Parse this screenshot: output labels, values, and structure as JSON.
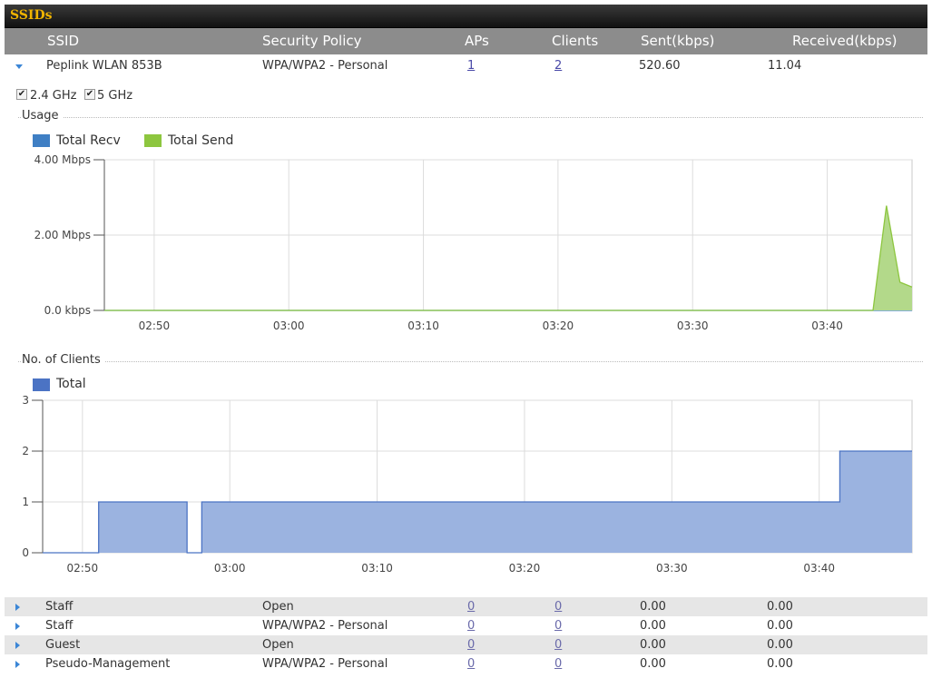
{
  "panel": {
    "title": "SSIDs"
  },
  "columns": {
    "ssid": "SSID",
    "security": "Security Policy",
    "aps": "APs",
    "clients": "Clients",
    "sent": "Sent(kbps)",
    "received": "Received(kbps)"
  },
  "expanded_row": {
    "ssid": "Peplink WLAN 853B",
    "security": "WPA/WPA2 - Personal",
    "aps": "1",
    "clients": "2",
    "sent": "520.60",
    "received": "11.04",
    "band_24": "2.4 GHz",
    "band_5": "5 GHz"
  },
  "rows": [
    {
      "ssid": "Staff",
      "security": "Open",
      "aps": "0",
      "clients": "0",
      "sent": "0.00",
      "received": "0.00"
    },
    {
      "ssid": "Staff",
      "security": "WPA/WPA2 - Personal",
      "aps": "0",
      "clients": "0",
      "sent": "0.00",
      "received": "0.00"
    },
    {
      "ssid": "Guest",
      "security": "Open",
      "aps": "0",
      "clients": "0",
      "sent": "0.00",
      "received": "0.00"
    },
    {
      "ssid": "Pseudo-Management",
      "security": "WPA/WPA2 - Personal",
      "aps": "0",
      "clients": "0",
      "sent": "0.00",
      "received": "0.00"
    }
  ],
  "usage": {
    "section_label": "Usage",
    "legend_recv": "Total Recv",
    "legend_send": "Total Send"
  },
  "clients_chart": {
    "section_label": "No. of Clients",
    "legend_total": "Total"
  },
  "colors": {
    "recv": "#3f7fc4",
    "send": "#8dc63f",
    "send_fill": "#b3d98a",
    "total": "#4b73c4",
    "total_fill": "#9bb3e0"
  },
  "chart_data": [
    {
      "type": "area",
      "ytick_labels": [
        "0.0 kbps",
        "2.00 Mbps",
        "4.00 Mbps"
      ],
      "ytick_values": [
        0,
        2,
        4
      ],
      "xtick_labels": [
        "02:50",
        "03:00",
        "03:10",
        "03:20",
        "03:30",
        "03:40"
      ],
      "x_minutes_tick": [
        50,
        60,
        70,
        80,
        90,
        100
      ],
      "xlim": [
        46.3,
        106.3
      ],
      "ylim": [
        0,
        4
      ],
      "series": [
        {
          "name": "Total Recv",
          "x": [
            46.3,
            106.3
          ],
          "y": [
            0,
            0
          ]
        },
        {
          "name": "Total Send",
          "x": [
            46.3,
            102.4,
            103.4,
            104.4,
            105.4,
            106.3
          ],
          "y": [
            0,
            0,
            0,
            2.78,
            0.75,
            0.62
          ]
        }
      ],
      "legend": "top-left",
      "grid": true
    },
    {
      "type": "area",
      "ytick_labels": [
        "0",
        "1",
        "2",
        "3"
      ],
      "ytick_values": [
        0,
        1,
        2,
        3
      ],
      "xtick_labels": [
        "02:50",
        "03:00",
        "03:10",
        "03:20",
        "03:30",
        "03:40"
      ],
      "x_minutes_tick": [
        50,
        60,
        70,
        80,
        90,
        100
      ],
      "xlim": [
        47.3,
        106.3
      ],
      "ylim": [
        0,
        3
      ],
      "series": [
        {
          "name": "Total",
          "x": [
            47.3,
            51.1,
            51.1,
            57.1,
            57.1,
            58.1,
            58.1,
            101.4,
            101.4,
            106.3
          ],
          "y": [
            0,
            0,
            1,
            1,
            0,
            0,
            1,
            1,
            2,
            2
          ]
        }
      ],
      "legend": "top-left",
      "grid": true
    }
  ]
}
